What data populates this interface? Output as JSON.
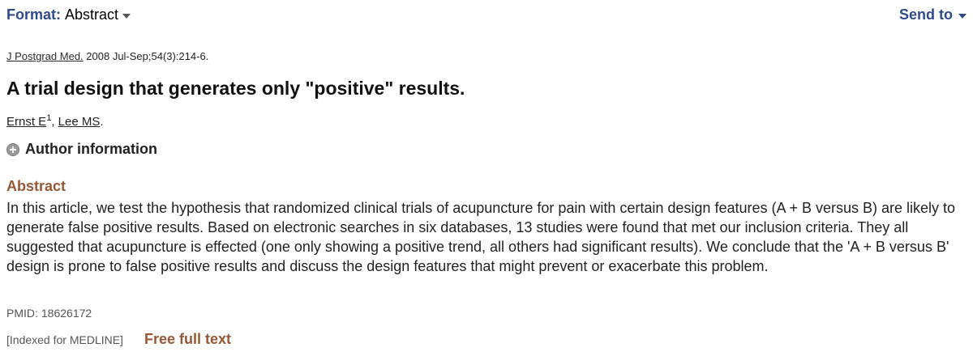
{
  "toolbar": {
    "format_label": "Format",
    "format_value": "Abstract",
    "send_to_label": "Send to"
  },
  "citation": {
    "journal": "J Postgrad Med.",
    "details": "2008 Jul-Sep;54(3):214-6."
  },
  "article": {
    "title": "A trial design that generates only \"positive\" results."
  },
  "authors": {
    "items": [
      {
        "name": "Ernst E",
        "affiliation": "1"
      },
      {
        "name": "Lee MS"
      }
    ],
    "separator": ", ",
    "terminator": "."
  },
  "author_info": {
    "label": "Author information",
    "icon": "plus-circle-icon"
  },
  "abstract": {
    "heading": "Abstract",
    "text": "In this article, we test the hypothesis that randomized clinical trials of acupuncture for pain with certain design features (A + B versus B) are likely to generate false positive results. Based on electronic searches in six databases, 13 studies were found that met our inclusion criteria. They all suggested that acupuncture is effected (one only showing a positive trend, all others had significant results). We conclude that the 'A + B versus B' design is prone to false positive results and discuss the design features that might prevent or exacerbate this problem."
  },
  "identifiers": {
    "pmid_label": "PMID:",
    "pmid_value": "18626172",
    "indexed": "[Indexed for MEDLINE]",
    "free_full_text": "Free full text"
  },
  "colors": {
    "link_blue": "#2f4a8a",
    "heading_brown": "#985735",
    "muted_gray": "#555555"
  }
}
